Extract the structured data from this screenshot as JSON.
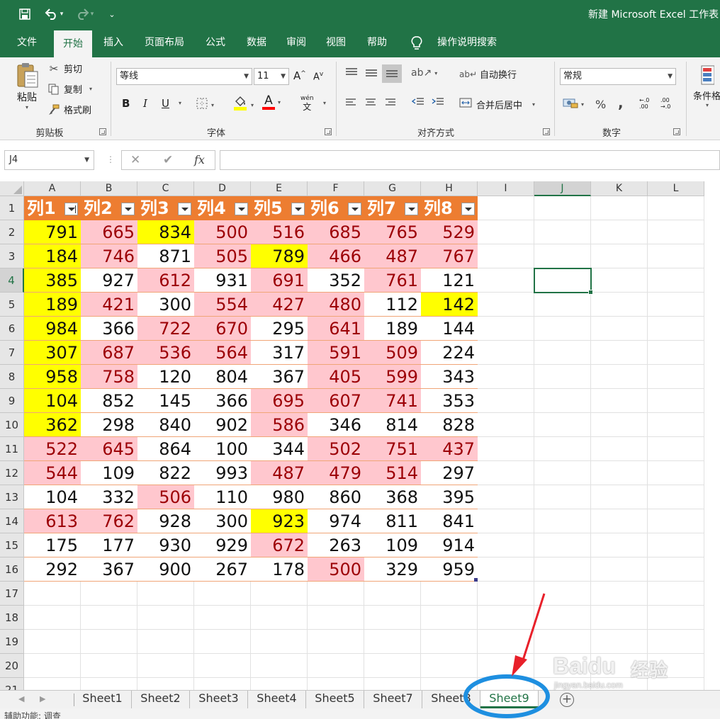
{
  "window": {
    "title": "新建 Microsoft Excel 工作表",
    "accent": "#217346"
  },
  "ribbon_tabs": [
    {
      "label": "文件",
      "active": false
    },
    {
      "label": "开始",
      "active": true
    },
    {
      "label": "插入",
      "active": false
    },
    {
      "label": "页面布局",
      "active": false
    },
    {
      "label": "公式",
      "active": false
    },
    {
      "label": "数据",
      "active": false
    },
    {
      "label": "审阅",
      "active": false
    },
    {
      "label": "视图",
      "active": false
    },
    {
      "label": "帮助",
      "active": false
    }
  ],
  "tell_me": "操作说明搜索",
  "clipboard": {
    "paste": "粘贴",
    "cut": "剪切",
    "copy": "复制",
    "format_painter": "格式刷",
    "group_label": "剪贴板"
  },
  "font": {
    "name": "等线",
    "size": "11",
    "bold": "B",
    "italic": "I",
    "underline": "U",
    "font_color_glyph": "A",
    "group_label": "字体",
    "fill_color": "#ffff00",
    "text_color": "#ff0000",
    "phonetic": "wén"
  },
  "alignment": {
    "wrap_text": "自动换行",
    "merge_center": "合并后居中",
    "group_label": "对齐方式"
  },
  "number": {
    "format": "常规",
    "percent": "%",
    "comma": ",",
    "inc_decimal": "←.0 .00",
    "dec_decimal": ".00 →.0",
    "group_label": "数字"
  },
  "styles": {
    "conditional_formatting": "条件格"
  },
  "formula_bar": {
    "name_box": "J4",
    "cancel": "✕",
    "enter": "✔",
    "fx": "fx",
    "value": ""
  },
  "grid": {
    "columns": [
      "A",
      "B",
      "C",
      "D",
      "E",
      "F",
      "G",
      "H",
      "I",
      "J",
      "K",
      "L"
    ],
    "rows": [
      "1",
      "2",
      "3",
      "4",
      "5",
      "6",
      "7",
      "8",
      "9",
      "10",
      "11",
      "12",
      "13",
      "14",
      "15",
      "16",
      "17",
      "18",
      "19",
      "20",
      "21"
    ],
    "selected_cell": "J4",
    "table": {
      "header_color": "#ed7d31",
      "headers": [
        "列1",
        "列2",
        "列3",
        "列4",
        "列5",
        "列6",
        "列7",
        "列8"
      ],
      "sorted_column": 0,
      "rows": [
        [
          791,
          665,
          834,
          500,
          516,
          685,
          765,
          529
        ],
        [
          184,
          746,
          871,
          505,
          789,
          466,
          487,
          767
        ],
        [
          385,
          927,
          612,
          931,
          691,
          352,
          761,
          121
        ],
        [
          189,
          421,
          300,
          554,
          427,
          480,
          112,
          142
        ],
        [
          984,
          366,
          722,
          670,
          295,
          641,
          189,
          144
        ],
        [
          307,
          687,
          536,
          564,
          317,
          591,
          509,
          224
        ],
        [
          958,
          758,
          120,
          804,
          367,
          405,
          599,
          343
        ],
        [
          104,
          852,
          145,
          366,
          695,
          607,
          741,
          353
        ],
        [
          362,
          298,
          840,
          902,
          586,
          346,
          814,
          828
        ],
        [
          522,
          645,
          864,
          100,
          344,
          502,
          751,
          437
        ],
        [
          544,
          109,
          822,
          993,
          487,
          479,
          514,
          297
        ],
        [
          104,
          332,
          506,
          110,
          980,
          860,
          368,
          395
        ],
        [
          613,
          762,
          928,
          300,
          923,
          974,
          811,
          841
        ],
        [
          175,
          177,
          930,
          929,
          672,
          263,
          109,
          914
        ],
        [
          292,
          367,
          900,
          267,
          178,
          500,
          329,
          959
        ]
      ],
      "highlight": [
        [
          "y",
          "p",
          "y",
          "p",
          "p",
          "p",
          "p",
          "p"
        ],
        [
          "y",
          "p",
          "n",
          "p",
          "y",
          "p",
          "p",
          "p"
        ],
        [
          "y",
          "n",
          "p",
          "n",
          "p",
          "n",
          "p",
          "n"
        ],
        [
          "y",
          "p",
          "n",
          "p",
          "p",
          "p",
          "n",
          "y"
        ],
        [
          "y",
          "n",
          "p",
          "p",
          "n",
          "p",
          "n",
          "n"
        ],
        [
          "y",
          "p",
          "p",
          "p",
          "n",
          "p",
          "p",
          "n"
        ],
        [
          "y",
          "p",
          "n",
          "n",
          "n",
          "p",
          "p",
          "n"
        ],
        [
          "y",
          "n",
          "n",
          "n",
          "p",
          "p",
          "p",
          "n"
        ],
        [
          "y",
          "n",
          "n",
          "n",
          "p",
          "n",
          "n",
          "n"
        ],
        [
          "p",
          "p",
          "n",
          "n",
          "n",
          "p",
          "p",
          "p"
        ],
        [
          "p",
          "n",
          "n",
          "n",
          "p",
          "p",
          "p",
          "n"
        ],
        [
          "n",
          "n",
          "p",
          "n",
          "n",
          "n",
          "n",
          "n"
        ],
        [
          "p",
          "p",
          "n",
          "n",
          "y",
          "n",
          "n",
          "n"
        ],
        [
          "n",
          "n",
          "n",
          "n",
          "p",
          "n",
          "n",
          "n"
        ],
        [
          "n",
          "n",
          "n",
          "n",
          "n",
          "p",
          "n",
          "n"
        ]
      ],
      "pink_fill": "#ffc7ce",
      "pink_text": "#9c0006",
      "yellow_fill": "#ffff00"
    }
  },
  "sheet_tabs": [
    {
      "label": "Sheet1",
      "active": false
    },
    {
      "label": "Sheet2",
      "active": false
    },
    {
      "label": "Sheet3",
      "active": false
    },
    {
      "label": "Sheet4",
      "active": false
    },
    {
      "label": "Sheet5",
      "active": false
    },
    {
      "label": "Sheet7",
      "active": false
    },
    {
      "label": "Sheet8",
      "active": false
    },
    {
      "label": "Sheet9",
      "active": true
    }
  ],
  "status": {
    "text": "辅助功能: 调查"
  },
  "annotation": {
    "arrow_color": "#e8202a",
    "circle_color": "#1e8fe0"
  },
  "watermark": {
    "brand": "Baidu",
    "cn": "经验",
    "url": "jingyan.baidu.com"
  }
}
